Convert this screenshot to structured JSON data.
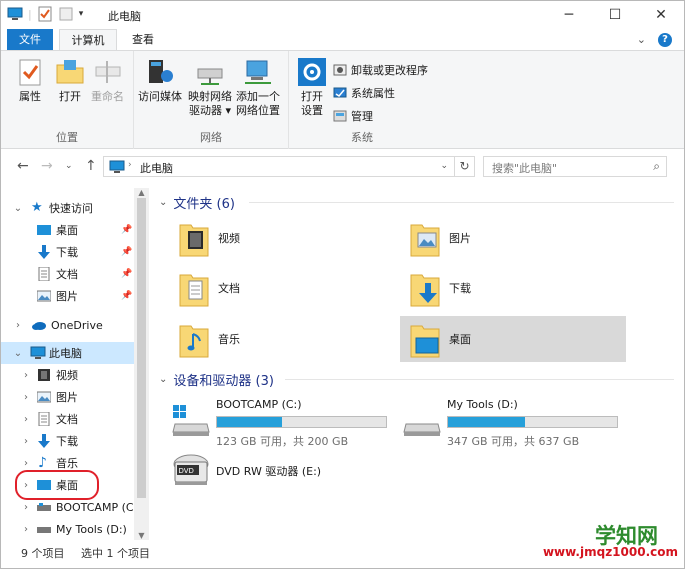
{
  "window": {
    "title": "此电脑",
    "controls": {
      "minimize": "─",
      "maximize": "☐",
      "close": "✕"
    }
  },
  "ribbon": {
    "tabs": [
      {
        "label": "文件"
      },
      {
        "label": "计算机"
      },
      {
        "label": "查看"
      }
    ],
    "groups": {
      "location": {
        "label": "位置",
        "buttons": [
          "属性",
          "打开",
          "重命名"
        ]
      },
      "network": {
        "label": "网络",
        "buttons": [
          {
            "line1": "访问媒体",
            "line2": ""
          },
          {
            "line1": "映射网络",
            "line2": "驱动器 ▾"
          },
          {
            "line1": "添加一个",
            "line2": "网络位置"
          }
        ]
      },
      "system": {
        "label": "系统",
        "open_settings": {
          "line1": "打开",
          "line2": "设置"
        },
        "small": [
          "卸载或更改程序",
          "系统属性",
          "管理"
        ]
      }
    }
  },
  "navigation": {
    "address": "此电脑",
    "search_placeholder": "搜索\"此电脑\""
  },
  "nav_pane": {
    "quick_access": "快速访问",
    "quick_items": [
      "桌面",
      "下载",
      "文档",
      "图片"
    ],
    "onedrive": "OneDrive",
    "this_pc": "此电脑",
    "pc_items": [
      "视频",
      "图片",
      "文档",
      "下载",
      "音乐",
      "桌面",
      "BOOTCAMP (C",
      "My Tools (D:)"
    ]
  },
  "content": {
    "folders_header": "文件夹 (6)",
    "folders": [
      "视频",
      "图片",
      "文档",
      "下载",
      "音乐",
      "桌面"
    ],
    "drives_header": "设备和驱动器 (3)",
    "drives": [
      {
        "name": "BOOTCAMP (C:)",
        "free_text": "123 GB 可用，共 200 GB",
        "used_fraction": 0.385
      },
      {
        "name": "My Tools (D:)",
        "free_text": "347 GB 可用，共 637 GB",
        "used_fraction": 0.455
      },
      {
        "name": "DVD RW 驱动器 (E:)"
      }
    ]
  },
  "status": {
    "count": "9 个项目",
    "selected": "选中 1 个项目"
  },
  "watermark": {
    "brand": "学知网",
    "url": "www.jmqz1000.com"
  },
  "colors": {
    "accent": "#1979ca",
    "drive_bar": "#26a0da",
    "selection": "#cce8ff",
    "folder": "#f8d775"
  }
}
